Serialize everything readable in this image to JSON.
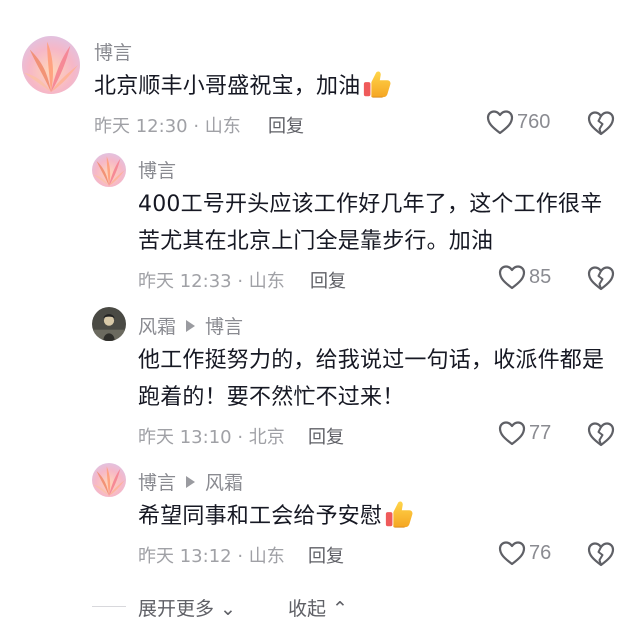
{
  "comments": [
    {
      "author": "博言",
      "reply_to": "",
      "text": "北京顺丰小哥盛祝宝，加油",
      "emoji": "thumbs-up",
      "time": "昨天 12:30",
      "location": "山东",
      "reply_label": "回复",
      "likes": "760"
    },
    {
      "author": "博言",
      "reply_to": "",
      "text": "400工号开头应该工作好几年了，这个工作很辛苦尤其在北京上门全是靠步行。加油",
      "emoji": "",
      "time": "昨天 12:33",
      "location": "山东",
      "reply_label": "回复",
      "likes": "85"
    },
    {
      "author": "风霜",
      "reply_to": "博言",
      "text": "他工作挺努力的，给我说过一句话，收派件都是跑着的！要不然忙不过来！",
      "emoji": "",
      "time": "昨天 13:10",
      "location": "北京",
      "reply_label": "回复",
      "likes": "77"
    },
    {
      "author": "博言",
      "reply_to": "风霜",
      "text": "希望同事和工会给予安慰",
      "emoji": "thumbs-up",
      "time": "昨天 13:12",
      "location": "山东",
      "reply_label": "回复",
      "likes": "76"
    }
  ],
  "footer": {
    "expand_more": "展开更多",
    "collapse": "收起"
  },
  "colors": {
    "text": "#161823",
    "secondary": "#8a8b91",
    "icon": "#5f6066"
  }
}
